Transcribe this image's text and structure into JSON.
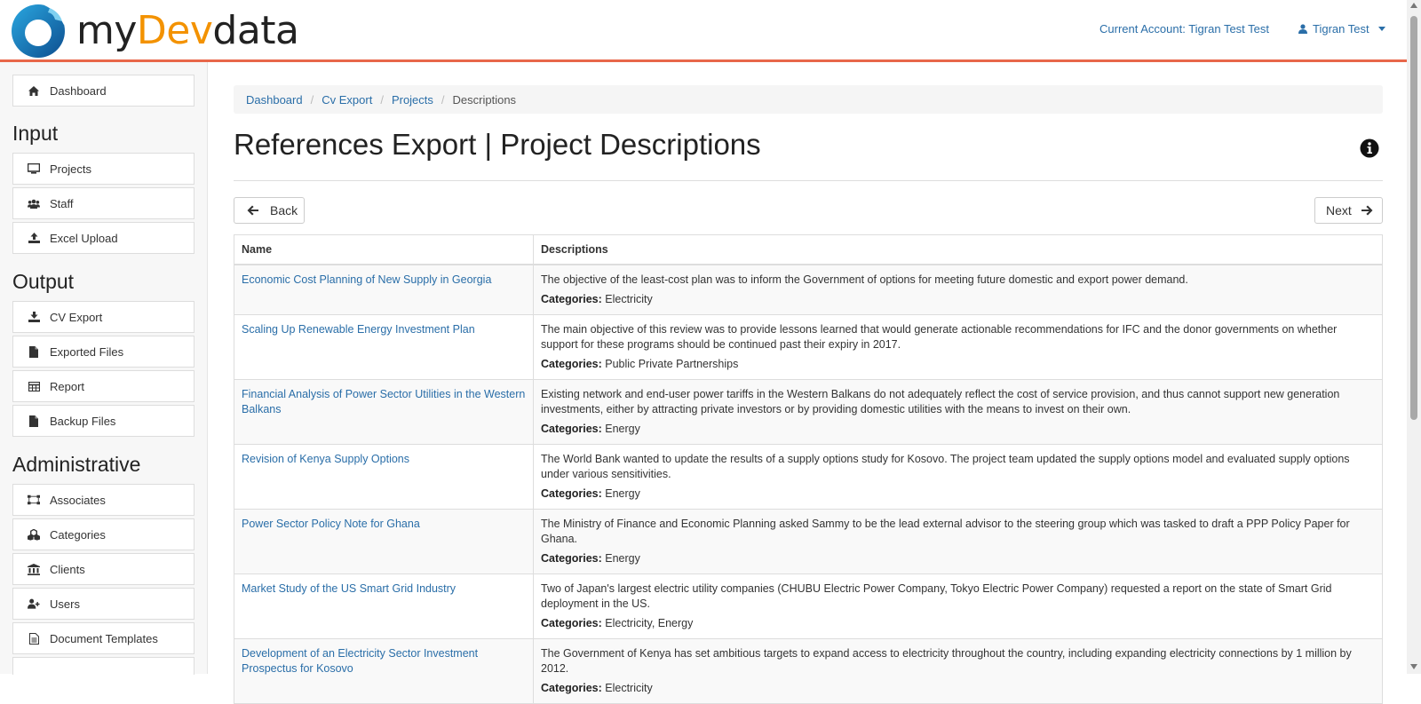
{
  "header": {
    "logo": {
      "prefix": "my",
      "accent": "Dev",
      "suffix": "data"
    },
    "account_label": "Current Account: Tigran Test Test",
    "user_name": "Tigran Test"
  },
  "sidebar": {
    "dashboard": "Dashboard",
    "input_heading": "Input",
    "input_items": [
      {
        "label": "Projects",
        "icon": "monitor-icon"
      },
      {
        "label": "Staff",
        "icon": "users-icon"
      },
      {
        "label": "Excel Upload",
        "icon": "upload-icon"
      }
    ],
    "output_heading": "Output",
    "output_items": [
      {
        "label": "CV Export",
        "icon": "download-icon"
      },
      {
        "label": "Exported Files",
        "icon": "file-icon"
      },
      {
        "label": "Report",
        "icon": "table-icon"
      },
      {
        "label": "Backup Files",
        "icon": "file-icon"
      }
    ],
    "admin_heading": "Administrative",
    "admin_items": [
      {
        "label": "Associates",
        "icon": "sitemap-icon"
      },
      {
        "label": "Categories",
        "icon": "cubes-icon"
      },
      {
        "label": "Clients",
        "icon": "bank-icon"
      },
      {
        "label": "Users",
        "icon": "user-plus-icon"
      },
      {
        "label": "Document Templates",
        "icon": "document-icon"
      }
    ]
  },
  "breadcrumb": [
    "Dashboard",
    "Cv Export",
    "Projects",
    "Descriptions"
  ],
  "page_title": "References Export | Project Descriptions",
  "buttons": {
    "back": "Back",
    "next": "Next"
  },
  "table": {
    "headers": [
      "Name",
      "Descriptions"
    ],
    "categories_label": "Categories:",
    "rows": [
      {
        "name": "Economic Cost Planning of New Supply in Georgia",
        "description": "The objective of the least-cost plan was to inform the Government of options for meeting future domestic and export power demand.",
        "categories": "Electricity"
      },
      {
        "name": "Scaling Up Renewable Energy Investment Plan",
        "description": "The main objective of this review was to provide lessons learned that would generate actionable recommendations for IFC and the donor governments on whether support for these programs should be continued past their expiry in 2017.",
        "categories": "Public Private Partnerships"
      },
      {
        "name": "Financial Analysis of Power Sector Utilities in the Western Balkans",
        "description": "Existing network and end-user power tariffs in the Western Balkans do not adequately reflect the cost of service provision, and thus cannot support new generation investments, either by attracting private investors or by providing domestic utilities with the means to invest on their own.",
        "categories": "Energy"
      },
      {
        "name": "Revision of Kenya Supply Options",
        "description": "The World Bank wanted to update the results of a supply options study for Kosovo. The project team updated the supply options model and evaluated supply options under various sensitivities.",
        "categories": "Energy"
      },
      {
        "name": "Power Sector Policy Note for Ghana",
        "description": "The Ministry of Finance and Economic Planning asked Sammy to be the lead external advisor to the steering group which was tasked to draft a PPP Policy Paper for Ghana.",
        "categories": "Energy"
      },
      {
        "name": "Market Study of the US Smart Grid Industry",
        "description": "Two of Japan's largest electric utility companies (CHUBU Electric Power Company, Tokyo Electric Power Company) requested a report on the state of Smart Grid deployment in the US.",
        "categories": "Electricity, Energy"
      },
      {
        "name": "Development of an Electricity Sector Investment Prospectus for Kosovo",
        "description": "The Government of Kenya has set ambitious targets to expand access to electricity throughout the country, including expanding electricity connections by 1 million by 2012.",
        "categories": "Electricity"
      }
    ]
  },
  "colors": {
    "accent_bar": "#e8674a",
    "link": "#2a6ea8",
    "logo_dev": "#f39200",
    "logo_mark": "#1a6fb5"
  }
}
